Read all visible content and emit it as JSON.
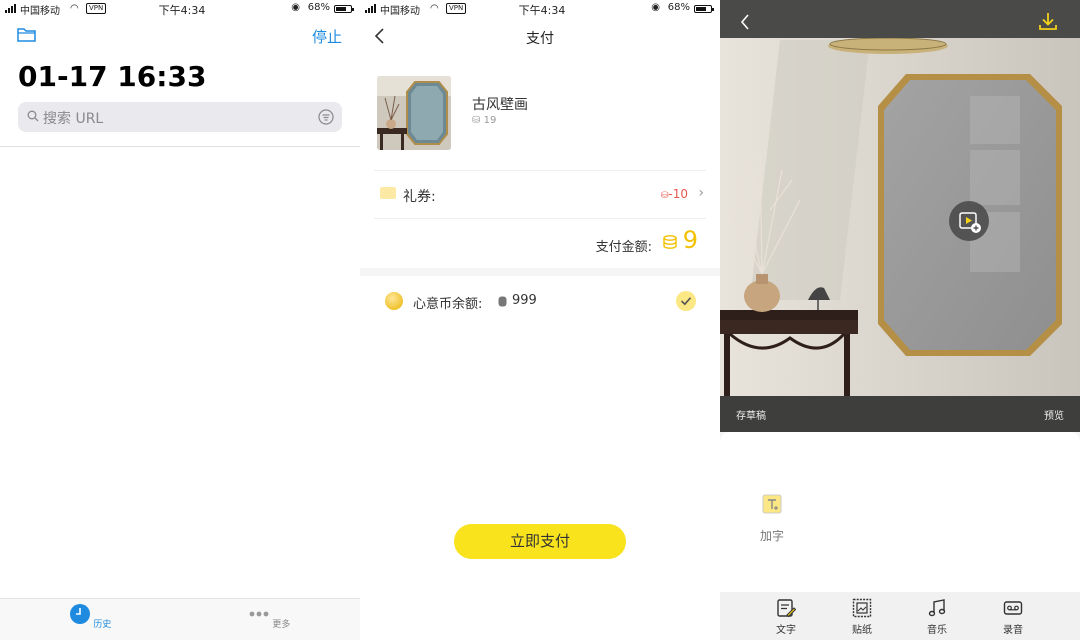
{
  "status_bar": {
    "carrier": "中国移动",
    "vpn": "VPN",
    "time": "下午4:34",
    "battery_pct": "68%"
  },
  "history_screen": {
    "stop_label": "停止",
    "heading": "01-17 16:33",
    "search_placeholder": "搜索 URL",
    "tabs": [
      {
        "label": "历史",
        "icon": "clock-icon",
        "active": true
      },
      {
        "label": "更多",
        "icon": "more-dots-icon",
        "active": false
      }
    ],
    "accent_color": "#1e8be0"
  },
  "payment_screen": {
    "title": "支付",
    "product": {
      "name": "古风壁画",
      "price": "19"
    },
    "coupon": {
      "label": "礼券:",
      "value": "-10"
    },
    "total": {
      "label": "支付金额:",
      "amount": "9"
    },
    "balance": {
      "label": "心意币余额:",
      "value": "999",
      "checked": true
    },
    "pay_button": "立即支付",
    "accent_color": "#f8e31d"
  },
  "editor_screen": {
    "save_draft": "存草稿",
    "preview": "预览",
    "add_text": "加字",
    "tools": [
      {
        "label": "文字",
        "icon": "text-edit-icon"
      },
      {
        "label": "贴纸",
        "icon": "sticker-icon"
      },
      {
        "label": "音乐",
        "icon": "music-icon"
      },
      {
        "label": "录音",
        "icon": "record-icon"
      }
    ]
  }
}
